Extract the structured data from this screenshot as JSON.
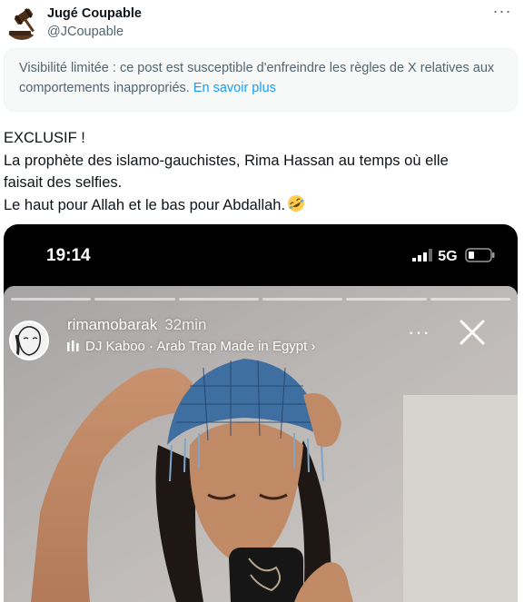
{
  "author": {
    "name": "Jugé Coupable",
    "handle": "@JCoupable"
  },
  "more_label": "···",
  "notice": {
    "text": "Visibilité limitée : ce post est susceptible d'enfreindre les règles de X relatives aux comportements inappropriés.",
    "link": "En savoir plus"
  },
  "tweet": {
    "lines": [
      "EXCLUSIF !",
      "La prophète des islamo-gauchistes, Rima Hassan au temps où elle",
      "faisait des selfies.",
      "Le haut pour Allah et le bas pour Abdallah."
    ],
    "emoji": "rolling-on-floor-laughing"
  },
  "media": {
    "phone_time": "19:14",
    "network": "5G",
    "story_user": "rimamobarak",
    "story_age": "32min",
    "story_music": "DJ Kaboo · Arab Trap Made in Egypt ›",
    "story_dots": "···"
  },
  "colors": {
    "link": "#1d9bf0",
    "secondary_text": "#536471",
    "notice_bg": "#f7f9f9"
  }
}
